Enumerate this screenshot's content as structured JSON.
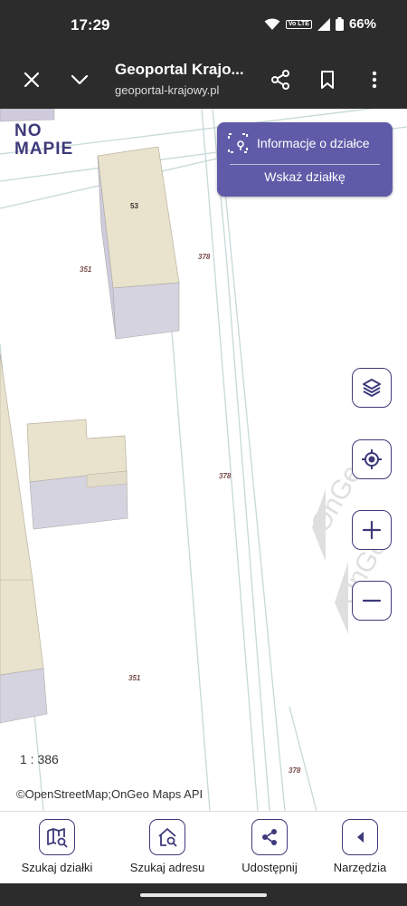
{
  "status": {
    "time": "17:29",
    "volte": "Vo LTE",
    "battery": "66%"
  },
  "browser": {
    "title": "Geoportal Krajo...",
    "url": "geoportal-krajowy.pl"
  },
  "map": {
    "logo_line1": "NO",
    "logo_line2": "MAPIE",
    "watermark": "OnGeo",
    "parcel_labels": [
      "53",
      "351",
      "378",
      "378",
      "351",
      "378"
    ],
    "info_panel": {
      "label": "Informacje o działce",
      "show_label": "Wskaż działkę"
    },
    "scale": "1 : 386",
    "attribution": "©OpenStreetMap;OnGeo Maps API"
  },
  "nav": {
    "search_parcel": "Szukaj działki",
    "search_address": "Szukaj adresu",
    "share": "Udostępnij",
    "tools": "Narzędzia"
  },
  "colors": {
    "accent": "#3d3a7a",
    "panel": "#5f5ba8",
    "bars": "#2c2c2c",
    "building_roof": "#e9e2cc",
    "building_wall": "#cfcbdc"
  },
  "icons": [
    "close-icon",
    "chevron-down-icon",
    "share-icon",
    "bookmark-icon",
    "more-vert-icon",
    "layers-icon",
    "locate-icon",
    "zoom-in-icon",
    "zoom-out-icon",
    "map-search-icon",
    "home-search-icon",
    "arrow-left-icon"
  ]
}
